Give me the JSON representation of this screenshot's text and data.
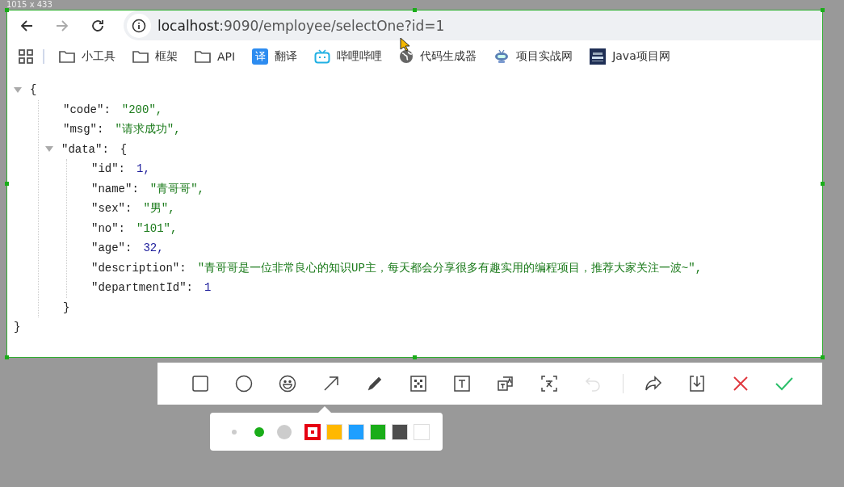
{
  "dimension_label": "1015 x 433",
  "browser": {
    "nav": [
      {
        "kind": "back",
        "disabled": false
      },
      {
        "kind": "forward",
        "disabled": true
      },
      {
        "kind": "reload",
        "disabled": false
      }
    ],
    "url_host": "localhost",
    "url_rest": ":9090/employee/selectOne?id=1",
    "bookmarks": [
      {
        "kind": "folder",
        "label": "小工具"
      },
      {
        "kind": "folder",
        "label": "框架"
      },
      {
        "kind": "folder",
        "label": "API"
      },
      {
        "kind": "translate",
        "label": "翻译",
        "badge": "译"
      },
      {
        "kind": "tv",
        "label": "哔哩哔哩"
      },
      {
        "kind": "globe",
        "label": "代码生成器"
      },
      {
        "kind": "robot",
        "label": "项目实战网"
      },
      {
        "kind": "book",
        "label": "Java项目网"
      }
    ]
  },
  "json_view": {
    "open": "{",
    "close": "}",
    "expanded": true,
    "members": [
      {
        "kind": "string",
        "key": "\"code\":",
        "value": "\"200\","
      },
      {
        "kind": "string",
        "key": "\"msg\":",
        "value": "\"请求成功\","
      },
      {
        "kind": "object",
        "key": "\"data\":",
        "open": "{",
        "close": "}",
        "expanded": true,
        "members": [
          {
            "kind": "number",
            "key": "\"id\":",
            "value": "1,"
          },
          {
            "kind": "string",
            "key": "\"name\":",
            "value": "\"青哥哥\","
          },
          {
            "kind": "string",
            "key": "\"sex\":",
            "value": "\"男\","
          },
          {
            "kind": "string",
            "key": "\"no\":",
            "value": "\"101\","
          },
          {
            "kind": "number",
            "key": "\"age\":",
            "value": "32,"
          },
          {
            "kind": "string",
            "key": "\"description\":",
            "value": "\"青哥哥是一位非常良心的知识UP主，每天都会分享很多有趣实用的编程项目，推荐大家关注一波~\","
          },
          {
            "kind": "number",
            "key": "\"departmentId\":",
            "value": "1"
          }
        ]
      }
    ]
  },
  "toolbar": {
    "tools": [
      {
        "kind": "rect",
        "disabled": false
      },
      {
        "kind": "ellipse",
        "disabled": false
      },
      {
        "kind": "emoji",
        "disabled": false
      },
      {
        "kind": "arrow",
        "disabled": false
      },
      {
        "kind": "pen",
        "disabled": false
      },
      {
        "kind": "mosaic",
        "disabled": false
      },
      {
        "kind": "text",
        "disabled": false
      },
      {
        "kind": "translate",
        "disabled": false
      },
      {
        "kind": "ocr",
        "disabled": false
      },
      {
        "kind": "undo",
        "disabled": true
      }
    ],
    "actions": [
      {
        "kind": "share",
        "disabled": false
      },
      {
        "kind": "save",
        "disabled": false
      },
      {
        "kind": "cancel",
        "disabled": false
      },
      {
        "kind": "confirm",
        "disabled": false
      }
    ]
  },
  "palette": {
    "sizes": [
      {
        "kind": "small",
        "selected": false
      },
      {
        "kind": "medium",
        "selected": true
      },
      {
        "kind": "large",
        "selected": false
      }
    ],
    "colors": [
      {
        "color": "#e60012",
        "selected": true
      },
      {
        "color": "#ffb800",
        "selected": false
      },
      {
        "color": "#1e9fff",
        "selected": false
      },
      {
        "color": "#1aad19",
        "selected": false
      },
      {
        "color": "#4d4d4d",
        "selected": false
      },
      {
        "color": "#ffffff",
        "selected": false
      }
    ]
  }
}
